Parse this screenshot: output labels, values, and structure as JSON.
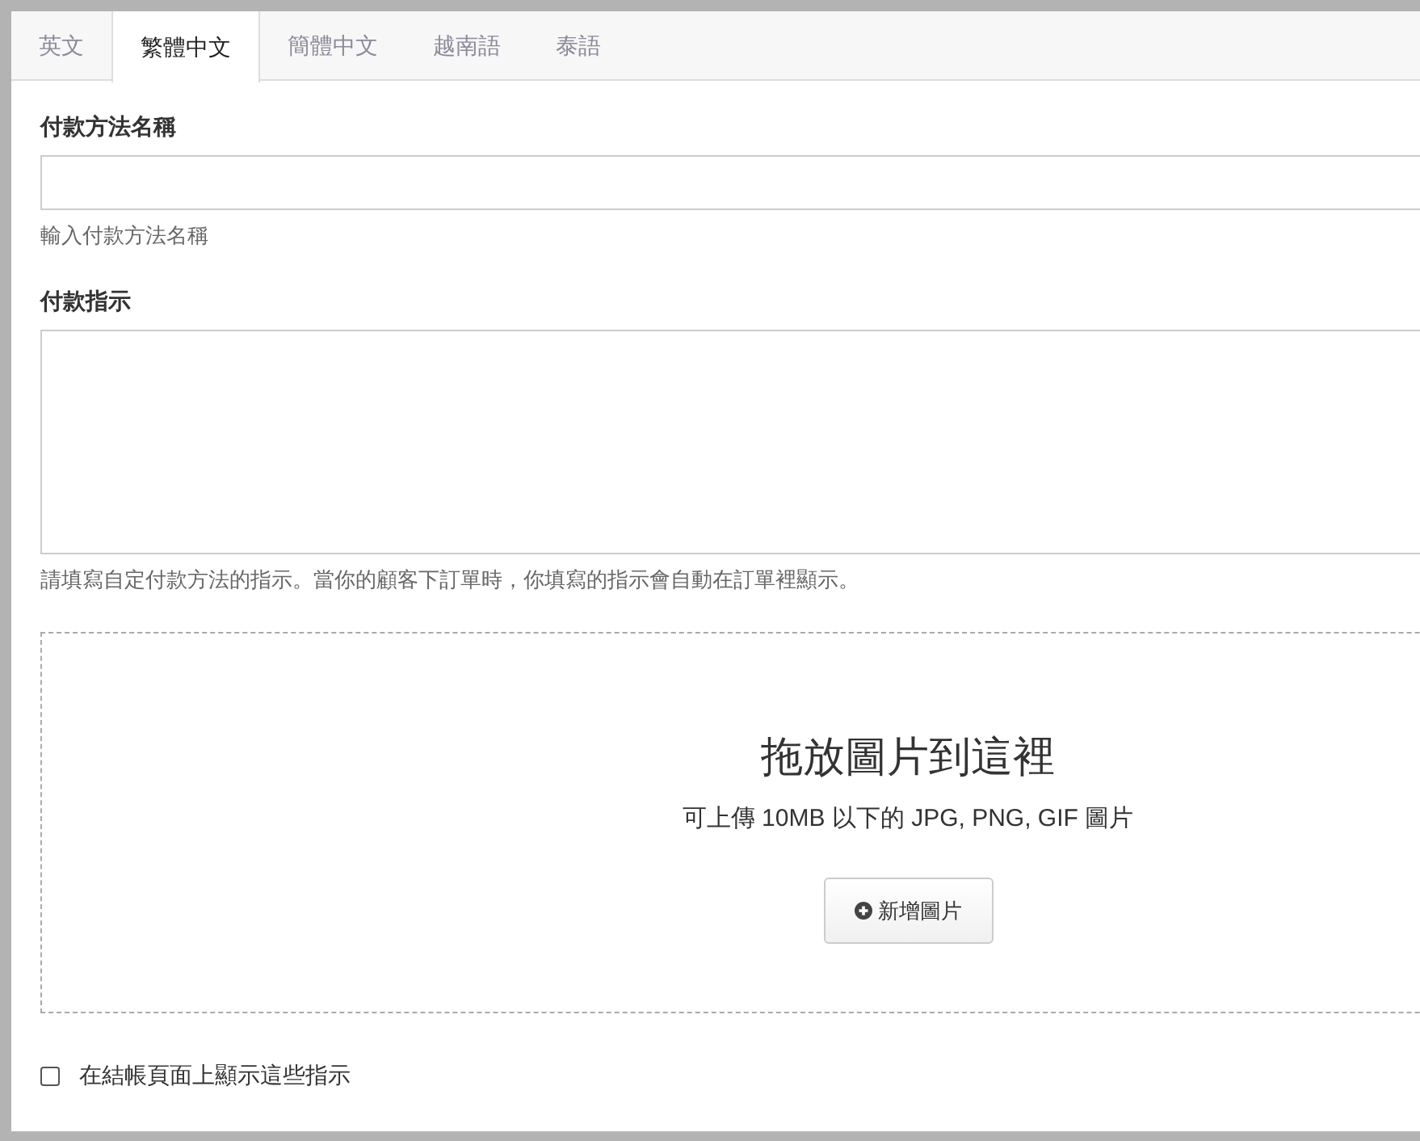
{
  "tabs": [
    {
      "label": "英文",
      "selected": false
    },
    {
      "label": "繁體中文",
      "selected": true
    },
    {
      "label": "簡體中文",
      "selected": false
    },
    {
      "label": "越南語",
      "selected": false
    },
    {
      "label": "泰語",
      "selected": false
    }
  ],
  "name_field": {
    "label": "付款方法名稱",
    "help": "輸入付款方法名稱"
  },
  "instructions_field": {
    "label": "付款指示",
    "help": "請填寫自定付款方法的指示。當你的顧客下訂單時，你填寫的指示會自動在訂單裡顯示。"
  },
  "dropzone": {
    "title": "拖放圖片到這裡",
    "subtitle": "可上傳 10MB 以下的 JPG, PNG, GIF 圖片",
    "button": "新增圖片"
  },
  "show_on_checkout": {
    "label": "在結帳頁面上顯示這些指示",
    "checked": false
  }
}
